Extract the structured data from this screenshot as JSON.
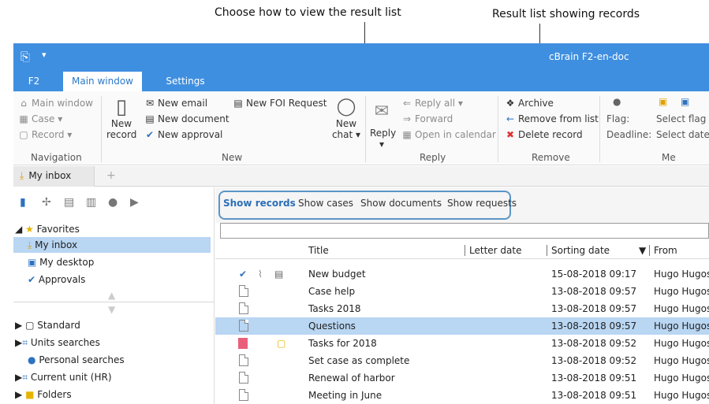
{
  "callouts": {
    "left": "Choose how to view the result list",
    "right": "Result list showing records"
  },
  "titlebar": {
    "quick_access_icon": "app-icon",
    "quick_access_dropdown": "▾",
    "title": "cBrain F2-en-doc"
  },
  "tabs": [
    {
      "label": "F2"
    },
    {
      "label": "Main window"
    },
    {
      "label": "Settings"
    }
  ],
  "ribbon": {
    "navigation": {
      "main_window": "Main window",
      "case": "Case",
      "record": "Record",
      "group": "Navigation"
    },
    "new": {
      "new_record_1": "New",
      "new_record_2": "record",
      "new_email": "New email",
      "new_document": "New document",
      "new_approval": "New approval",
      "new_foi": "New FOI Request",
      "new_chat_1": "New",
      "new_chat_2": "chat",
      "group": "New"
    },
    "reply": {
      "reply": "Reply",
      "reply_all": "Reply all",
      "forward": "Forward",
      "open_calendar": "Open in calendar",
      "group": "Reply"
    },
    "remove": {
      "archive": "Archive",
      "remove_from_list": "Remove from list",
      "delete_record": "Delete record",
      "group": "Remove"
    },
    "me": {
      "flag_label": "Flag:",
      "deadline_label": "Deadline:",
      "select_flag": "Select flag",
      "select_date": "Select date",
      "group": "Me"
    }
  },
  "doctab": {
    "label": "My inbox",
    "add": "+"
  },
  "tree": {
    "favorites": "Favorites",
    "my_inbox": "My inbox",
    "my_desktop": "My desktop",
    "approvals": "Approvals",
    "standard": "Standard",
    "units_searches": "Units searches",
    "personal_searches": "Personal searches",
    "current_unit": "Current unit (HR)",
    "folders": "Folders"
  },
  "view_options": {
    "records": "Show records",
    "cases": "Show cases",
    "documents": "Show documents",
    "requests": "Show requests"
  },
  "columns": {
    "title": "Title",
    "letter_date": "Letter date",
    "sorting_date": "Sorting date",
    "sort_indicator": "▼",
    "from": "From"
  },
  "rows": [
    {
      "title": "New budget",
      "sorting_date": "15-08-2018 09:17",
      "from": "Hugo Hugoser"
    },
    {
      "title": "Case help",
      "sorting_date": "13-08-2018 09:57",
      "from": "Hugo Hugoser"
    },
    {
      "title": "Tasks 2018",
      "sorting_date": "13-08-2018 09:57",
      "from": "Hugo Hugoser"
    },
    {
      "title": "Questions",
      "sorting_date": "13-08-2018 09:57",
      "from": "Hugo Hugoser"
    },
    {
      "title": "Tasks for 2018",
      "sorting_date": "13-08-2018 09:52",
      "from": "Hugo Hugoser"
    },
    {
      "title": "Set case as complete",
      "sorting_date": "13-08-2018 09:52",
      "from": "Hugo Hugoser"
    },
    {
      "title": "Renewal of harbor",
      "sorting_date": "13-08-2018 09:51",
      "from": "Hugo Hugoser"
    },
    {
      "title": "Meeting in June",
      "sorting_date": "13-08-2018 09:51",
      "from": "Hugo Hugoser"
    }
  ],
  "colors": {
    "accent": "#3f8fe0",
    "selection": "#b9d6f2",
    "red_flag": "#e8607a"
  }
}
